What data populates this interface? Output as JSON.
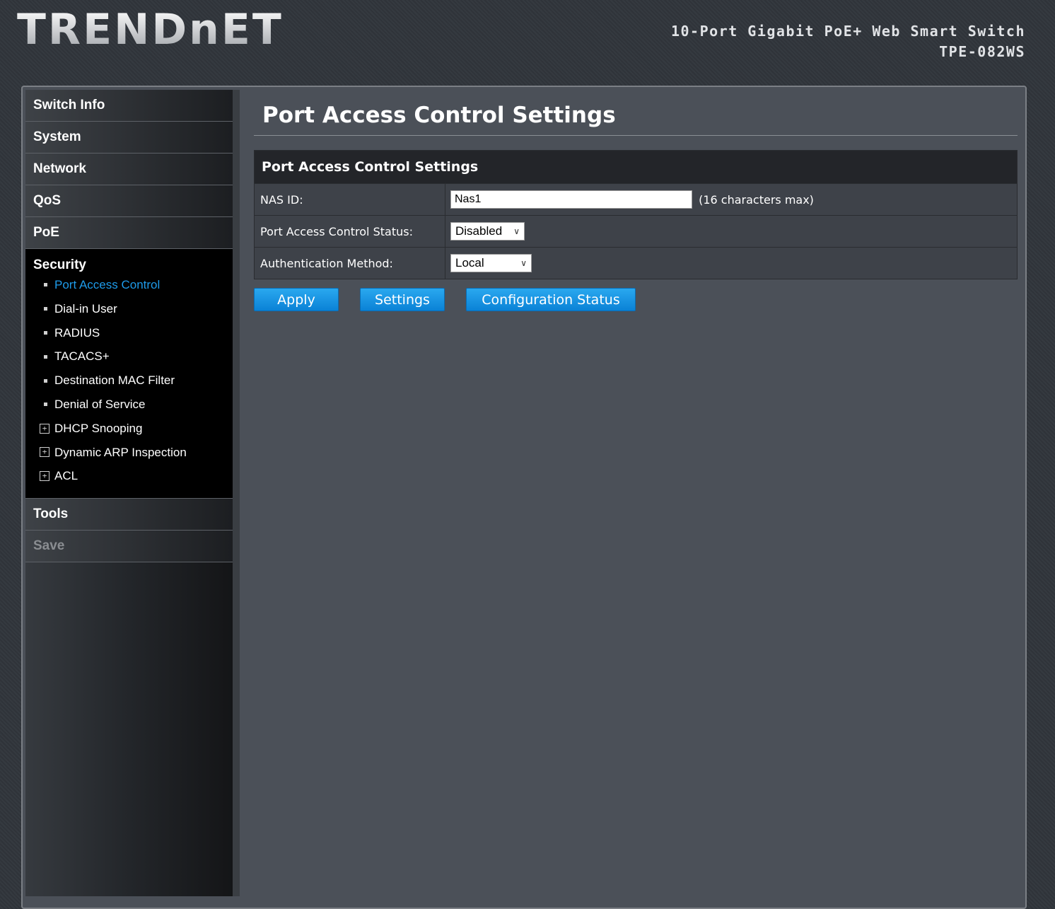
{
  "header": {
    "logo": "TRENDnET",
    "product_name": "10-Port Gigabit PoE+ Web Smart Switch",
    "model": "TPE-082WS"
  },
  "sidebar": {
    "items_top": [
      "Switch Info",
      "System",
      "Network",
      "QoS",
      "PoE"
    ],
    "security": {
      "title": "Security",
      "sub_items": [
        {
          "label": "Port Access Control",
          "type": "bullet",
          "active": true
        },
        {
          "label": "Dial-in User",
          "type": "bullet"
        },
        {
          "label": "RADIUS",
          "type": "bullet"
        },
        {
          "label": "TACACS+",
          "type": "bullet"
        },
        {
          "label": "Destination MAC Filter",
          "type": "bullet"
        },
        {
          "label": "Denial of Service",
          "type": "bullet"
        },
        {
          "label": "DHCP Snooping",
          "type": "expandable"
        },
        {
          "label": "Dynamic ARP Inspection",
          "type": "expandable"
        },
        {
          "label": "ACL",
          "type": "expandable"
        }
      ]
    },
    "tools": "Tools",
    "save": "Save"
  },
  "main": {
    "page_title": "Port Access Control Settings",
    "table": {
      "header": "Port Access Control Settings",
      "nas_id_label": "NAS ID:",
      "nas_id_value": "Nas1",
      "nas_id_hint": "(16 characters max)",
      "status_label": "Port Access Control Status:",
      "status_value": "Disabled",
      "auth_label": "Authentication Method:",
      "auth_value": "Local"
    },
    "buttons": {
      "apply": "Apply",
      "settings": "Settings",
      "config_status": "Configuration Status"
    }
  },
  "colors": {
    "accent": "#1e9bea",
    "button": "#0a82d6"
  }
}
